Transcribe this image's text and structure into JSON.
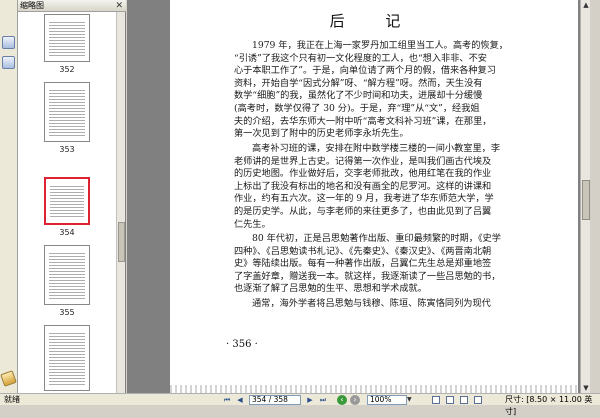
{
  "left_panel": {
    "title": "缩略图",
    "close_icon": "✕"
  },
  "thumbnails": [
    {
      "label": "352",
      "selected": false
    },
    {
      "label": "353",
      "selected": false
    },
    {
      "label": "354",
      "selected": true
    },
    {
      "label": "355",
      "selected": false
    }
  ],
  "document": {
    "title": "后 记",
    "paragraphs": [
      [
        "1979 年，我正在上海一家罗丹加工组里当工人。高考的恢复，",
        "“引诱”了我这个只有初一文化程度的工人，也“想入非非、不安",
        "心于本职工作了”。于是，向单位请了两个月的假，借来各种复习",
        "资料，开始自学“因式分解”呀、“解方程”呀。然而，天生没有",
        "数学“细胞”的我，虽然化了不少时间和功夫，进展却十分缓慢",
        "(高考时，数学仅得了 30 分)。于是，弃“理”从“文”，经我姐",
        "夫的介绍，去华东师大一附中听“高考文科补习班”课，在那里，",
        "第一次见到了附中的历史老师李永圻先生。"
      ],
      [
        "高考补习班的课，安排在附中数学楼三楼的一间小教室里，李",
        "老师讲的是世界上古史。记得第一次作业，是叫我们画古代埃及",
        "的历史地图。作业做好后，交李老师批改，他用红笔在我的作业",
        "上标出了我没有标出的地名和没有画全的尼罗河。这样的讲课和",
        "作业，约有五六次。这一年的 9 月，我考进了华东师范大学，学",
        "的是历史学。从此，与李老师的来往更多了，也由此见到了吕翼",
        "仁先生。"
      ],
      [
        "80 年代初，正是吕思勉著作出版、重印最频繁的时期，《史学",
        "四种》、《吕思勉读书札记》、《先秦史》、《秦汉史》、《两晋南北朝",
        "史》等陆续出版。每有一种著作出版，吕翼仁先生总是郑重地签",
        "了字盖好章，赠送我一本。就这样，我逐渐读了一些吕思勉的书，",
        "也逐渐了解了吕思勉的生平、思想和学术成就。"
      ],
      [
        "通常，海外学者将吕思勉与钱穆、陈垣、陈寅恪同列为现代"
      ]
    ],
    "page_number": "· 356 ·"
  },
  "statusbar": {
    "left_text": "就绪",
    "first_page_icon": "⏮",
    "prev_page_icon": "◀",
    "page_field": "354 / 358",
    "next_page_icon": "▶",
    "last_page_icon": "⏭",
    "zoom_field": "100%",
    "zoom_dropdown_icon": "▼",
    "page_size": "尺寸: [8.50 × 11.00 英寸]"
  }
}
